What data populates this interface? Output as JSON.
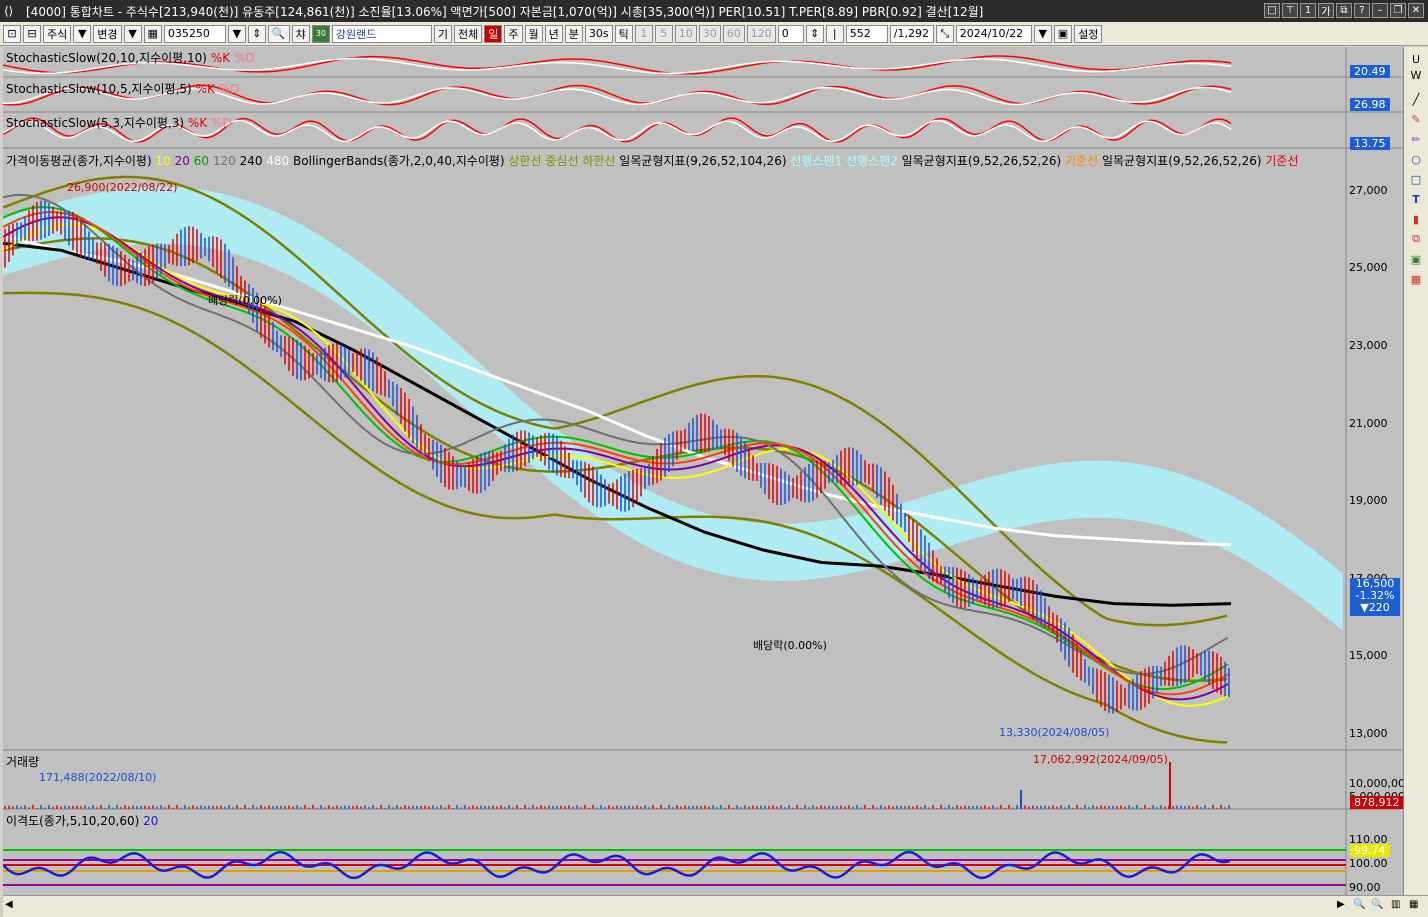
{
  "window": {
    "title": "[4000] 통합차트 - 주식수[213,940(천)] 유동주[124,861(천)] 소진율[13.06%] 액면가[500] 자본금[1,070(억)] 시총[35,300(억)] PER[10.51] T.PER[8.89] PBR[0.92] 결산[12월]"
  },
  "toolbar": {
    "market": "주식",
    "change": "변경",
    "code": "035250",
    "chart_btn": "챠",
    "code_btn": "30",
    "name": "강원랜드",
    "gi": "기",
    "all": "전체",
    "periods": [
      "일",
      "주",
      "월",
      "년",
      "분",
      "30s",
      "틱"
    ],
    "active_period": "일",
    "nums": [
      "1",
      "5",
      "10",
      "30",
      "60",
      "120"
    ],
    "zero": "0",
    "count": "552",
    "total": "/1,292",
    "date": "2024/10/22",
    "settings": "설정"
  },
  "panels": {
    "stoch1": {
      "name": "StochasticSlow(20,10,지수이평,10)",
      "k": "%K",
      "d": "%D",
      "value": "20.49"
    },
    "stoch2": {
      "name": "StochasticSlow(10,5,지수이평,5)",
      "k": "%K",
      "d": "%D",
      "value": "26.98"
    },
    "stoch3": {
      "name": "StochasticSlow(5,3,지수이평,3)",
      "k": "%K",
      "d": "%D",
      "value": "13.75"
    },
    "price": {
      "ma_name": "가격이동평균(종가,지수이평)",
      "ma_periods": [
        "10",
        "20",
        "60",
        "120",
        "240",
        "480"
      ],
      "bb_name": "BollingerBands(종가,2,0,40,지수이평)",
      "bb_lines": [
        "상한선",
        "중심선",
        "하한선"
      ],
      "ich1_name": "일목균형지표(9,26,52,104,26)",
      "ich1_lines": [
        "선행스팬1",
        "선행스팬2"
      ],
      "ich2_name": "일목균형지표(9,52,26,52,26)",
      "ich2_line": "기준선",
      "ich3_name": "일목균형지표(9,52,26,52,26)",
      "ich3_line": "기준선",
      "yticks": [
        "27,000",
        "25,000",
        "23,000",
        "21,000",
        "19,000",
        "17,000",
        "15,000",
        "13,000"
      ],
      "current_price": "16,500",
      "change_pct": "-1.32%",
      "change_abs": "▼220",
      "high_annot": "26,900(2022/08/22)",
      "low_annot": "13,330(2024/08/05)",
      "div1": "배당락(0.00%)",
      "div2": "배당락(0.00%)"
    },
    "volume": {
      "name": "거래량",
      "max_annot": "171,488(2022/08/10)",
      "peak_annot": "17,062,992(2024/09/05)",
      "ytick1": "10,000,000",
      "ytick2": "5,000,000",
      "value": "878,912"
    },
    "disparity": {
      "name": "이격도(종가,5,10,20,60)",
      "period": "20",
      "ytick1": "110.00",
      "ytick2": "100.00",
      "ytick3": "90.00",
      "value": "99.74"
    }
  },
  "chart_data": {
    "type": "line",
    "title": "",
    "xlabel": "",
    "ylabel": "",
    "ylim": [
      12500,
      28000
    ],
    "series": [
      {
        "name": "가격이동평균(종가,지수이평) 480",
        "color": "#ffffff",
        "values": [
          26400,
          26000,
          25700,
          25300,
          24800,
          24300,
          23800,
          23300,
          22700,
          22100,
          21500,
          20800,
          20200,
          19700,
          19200,
          18800,
          18500,
          18200,
          18000,
          17900,
          17800,
          17750
        ]
      },
      {
        "name": "가격이동평균(종가,지수이평) 240",
        "color": "#000000",
        "values": [
          26200,
          26000,
          25500,
          25000,
          24500,
          24000,
          23200,
          22300,
          21400,
          20500,
          19600,
          18800,
          18100,
          17600,
          17250,
          17150,
          16900,
          16600,
          16300,
          16100,
          16050,
          16100
        ]
      }
    ]
  }
}
